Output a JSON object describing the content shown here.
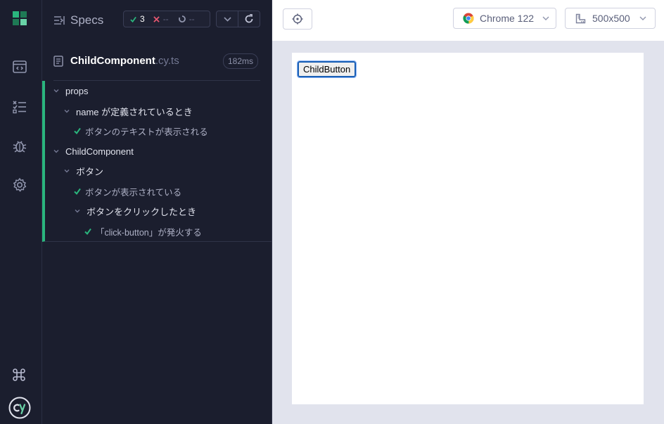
{
  "rail": {
    "icons": [
      "cypress-logo-icon",
      "specs-list-icon",
      "runs-icon",
      "debug-icon",
      "settings-icon",
      "keyboard-shortcuts-icon",
      "cypress-cy-logo-icon"
    ]
  },
  "reporter": {
    "specs_label": "Specs",
    "stats": {
      "passed": "3",
      "failed": "--",
      "pending": "--"
    },
    "file": {
      "name": "ChildComponent",
      "ext": ".cy.ts",
      "duration": "182ms"
    },
    "tree": [
      {
        "kind": "suite",
        "label": "props"
      },
      {
        "kind": "suite",
        "label": "name が定義されているとき"
      },
      {
        "kind": "test",
        "label": "ボタンのテキストが表示される",
        "state": "passed"
      },
      {
        "kind": "suite",
        "label": "ChildComponent"
      },
      {
        "kind": "suite",
        "label": "ボタン"
      },
      {
        "kind": "test",
        "label": "ボタンが表示されている",
        "state": "passed"
      },
      {
        "kind": "suite",
        "label": "ボタンをクリックしたとき"
      },
      {
        "kind": "test",
        "label": "「click-button」が発火する",
        "state": "passed"
      }
    ]
  },
  "toolbar": {
    "browser_label": "Chrome 122",
    "viewport_label": "500x500"
  },
  "aut": {
    "button_label": "ChildButton"
  },
  "colors": {
    "pass": "#2ab57d",
    "fail": "#e45770",
    "background_dark": "#1b1e2e",
    "aut_backdrop": "#e1e3ed"
  }
}
